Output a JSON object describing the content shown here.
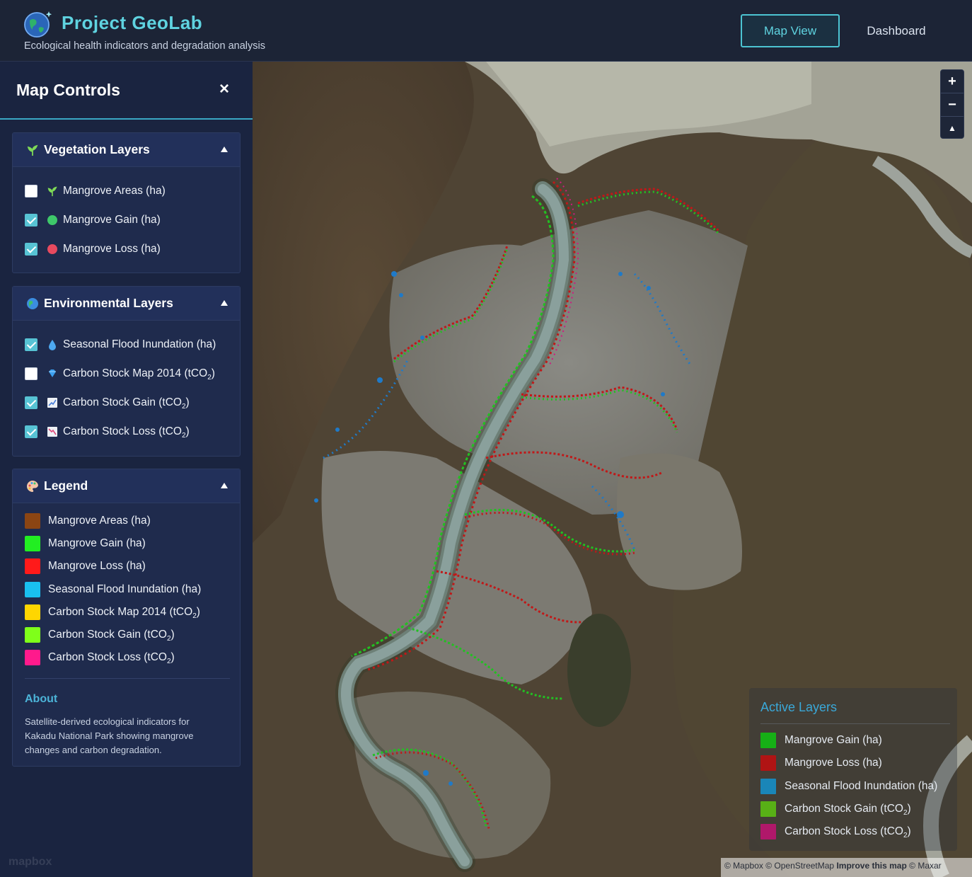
{
  "header": {
    "title": "Project GeoLab",
    "subtitle": "Ecological health indicators and degradation analysis",
    "nav": {
      "map_view": "Map View",
      "dashboard": "Dashboard"
    }
  },
  "sidebar": {
    "title": "Map Controls",
    "close_icon": "×",
    "vegetation": {
      "title": "Vegetation Layers",
      "icon": "plant-icon",
      "layers": [
        {
          "label": "Mangrove Areas (ha)",
          "checked": false,
          "icon": "plant-icon"
        },
        {
          "label": "Mangrove Gain (ha)",
          "checked": true,
          "icon": "green-dot-icon",
          "color": "#3ec86a"
        },
        {
          "label": "Mangrove Loss (ha)",
          "checked": true,
          "icon": "red-dot-icon",
          "color": "#e84a5f"
        }
      ]
    },
    "environmental": {
      "title": "Environmental Layers",
      "icon": "globe-icon",
      "layers": [
        {
          "label": "Seasonal Flood Inundation (ha)",
          "checked": true,
          "icon": "droplet-icon"
        },
        {
          "label_main": "Carbon Stock Map 2014 (tCO",
          "sub": "2",
          "tail": ")",
          "checked": false,
          "icon": "gem-icon"
        },
        {
          "label_main": "Carbon Stock Gain (tCO",
          "sub": "2",
          "tail": ")",
          "checked": true,
          "icon": "chart-up-icon"
        },
        {
          "label_main": "Carbon Stock Loss (tCO",
          "sub": "2",
          "tail": ")",
          "checked": true,
          "icon": "chart-down-icon"
        }
      ]
    },
    "legend": {
      "title": "Legend",
      "icon": "palette-icon",
      "items": [
        {
          "label": "Mangrove Areas (ha)",
          "color": "#8b4513"
        },
        {
          "label": "Mangrove Gain (ha)",
          "color": "#22ee22"
        },
        {
          "label": "Mangrove Loss (ha)",
          "color": "#ff1a1a"
        },
        {
          "label": "Seasonal Flood Inundation (ha)",
          "color": "#19c0f0"
        },
        {
          "label_main": "Carbon Stock Map 2014 (tCO",
          "sub": "2",
          "tail": ")",
          "color": "#ffd600"
        },
        {
          "label_main": "Carbon Stock Gain (tCO",
          "sub": "2",
          "tail": ")",
          "color": "#7fff1a"
        },
        {
          "label_main": "Carbon Stock Loss (tCO",
          "sub": "2",
          "tail": ")",
          "color": "#ff1a8c"
        }
      ],
      "about_title": "About",
      "about_text": "Satellite-derived ecological indicators for Kakadu National Park showing mangrove changes and carbon degradation."
    },
    "watermark": "mapbox"
  },
  "map": {
    "zoom_in": "+",
    "zoom_out": "−",
    "compass": "▲",
    "active_layers": {
      "title": "Active Layers",
      "items": [
        {
          "label": "Mangrove Gain (ha)",
          "color": "#16b016"
        },
        {
          "label": "Mangrove Loss (ha)",
          "color": "#b01414"
        },
        {
          "label": "Seasonal Flood Inundation (ha)",
          "color": "#1a86b8"
        },
        {
          "label_main": "Carbon Stock Gain (tCO",
          "sub": "2",
          "tail": ")",
          "color": "#58b016"
        },
        {
          "label_main": "Carbon Stock Loss (tCO",
          "sub": "2",
          "tail": ")",
          "color": "#b0186a"
        }
      ]
    },
    "attribution": {
      "mapbox": "© Mapbox",
      "osm": "© OpenStreetMap",
      "improve": "Improve this map",
      "maxar": "© Maxar"
    }
  }
}
